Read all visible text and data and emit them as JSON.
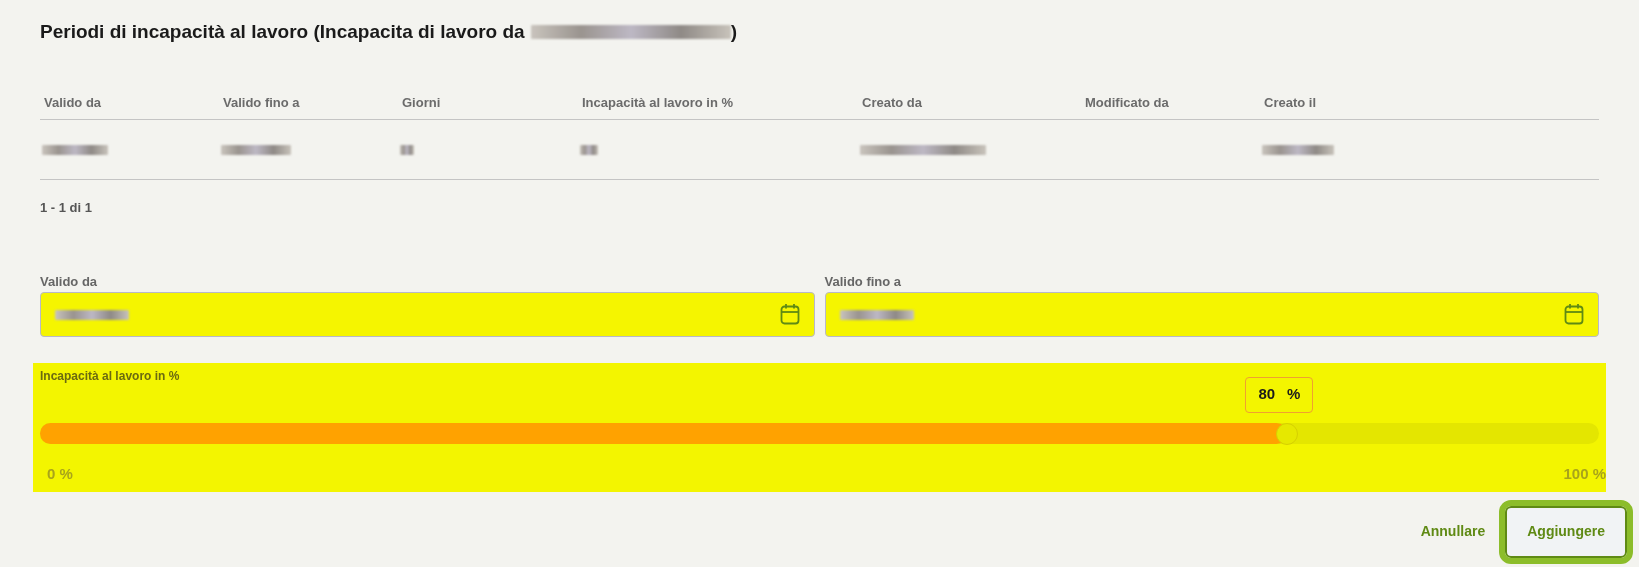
{
  "title": {
    "prefix": "Periodi di incapacità al lavoro (Incapacita di lavoro da",
    "redacted": true,
    "suffix": ")"
  },
  "table": {
    "columns": [
      "Valido da",
      "Valido fino a",
      "Giorni",
      "Incapacità al lavoro in %",
      "Creato da",
      "Modificato da",
      "Creato il"
    ],
    "rows": [
      {
        "cells": [
          {
            "kind": "blurred"
          },
          {
            "kind": "blurred"
          },
          {
            "kind": "blurred"
          },
          {
            "kind": "blurred"
          },
          {
            "kind": "blurred"
          },
          {
            "kind": "empty"
          },
          {
            "kind": "blurred"
          }
        ]
      }
    ]
  },
  "pagination": "1 - 1 di 1",
  "fields": [
    {
      "label": "Valido da",
      "value_redacted": true
    },
    {
      "label": "Valido fino a",
      "value_redacted": true
    }
  ],
  "slider": {
    "label": "Incapacità al lavoro in %",
    "level": 0.8,
    "value": "80",
    "unit": "%",
    "min_label": "0 %",
    "max_label": "100 %"
  },
  "buttons": [
    {
      "label": "Annullare",
      "kind": "text"
    },
    {
      "label": "Aggiungere",
      "kind": "outlined",
      "focused": true
    }
  ]
}
